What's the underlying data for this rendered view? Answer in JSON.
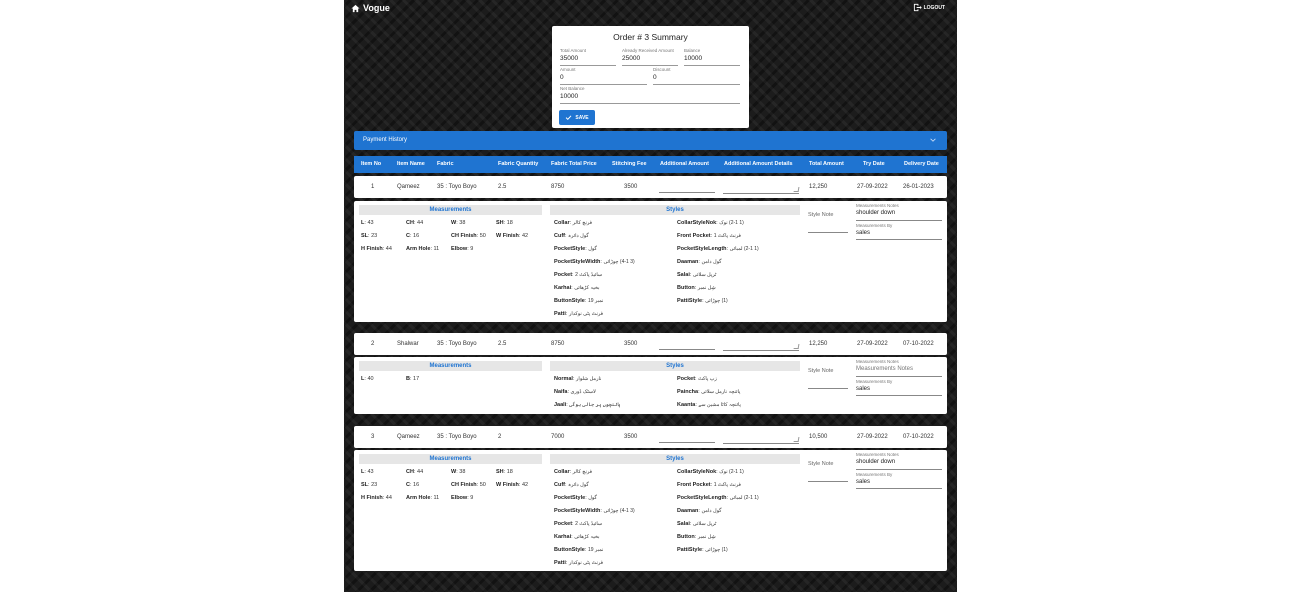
{
  "app": {
    "brand": "Vogue",
    "logout": "LOGOUT"
  },
  "summary": {
    "title": "Order # 3 Summary",
    "total_amount": {
      "label": "Total Amount",
      "value": "35000"
    },
    "already_received": {
      "label": "Already Received Amount",
      "value": "25000"
    },
    "balance": {
      "label": "Balance",
      "value": "10000"
    },
    "amount": {
      "label": "Amount",
      "value": "0"
    },
    "discount": {
      "label": "Discount",
      "value": "0"
    },
    "net_balance": {
      "label": "Net Balance",
      "value": "10000"
    },
    "save_label": "SAVE"
  },
  "payment_history": {
    "label": "Payment History"
  },
  "columns": [
    "Item No",
    "Item Name",
    "Fabric",
    "Fabric Quantity",
    "Fabric Total Price",
    "Stitching Fee",
    "Additional Amount",
    "Additional Amount Details",
    "Total Amount",
    "Try Date",
    "Delivery Date"
  ],
  "items": [
    {
      "no": "1",
      "name": "Qameez",
      "fabric": "35 : Toyo Boyo",
      "qty": "2.5",
      "fabric_price": "8750",
      "stitching_fee": "3500",
      "total": "12,250",
      "try_date": "27-09-2022",
      "delivery_date": "26-01-2023",
      "measurements_title": "Measurements",
      "styles_title": "Styles",
      "style_note": "Style Note",
      "notes_label": "Measurements Notes",
      "notes_value": "shoulder down",
      "by_label": "Measurements By",
      "by_value": "sales",
      "measurements": [
        {
          "k": "L",
          "v": "43"
        },
        {
          "k": "CH",
          "v": "44"
        },
        {
          "k": "W",
          "v": "38"
        },
        {
          "k": "SH",
          "v": "18"
        },
        {
          "k": "SL",
          "v": "23"
        },
        {
          "k": "C",
          "v": "16"
        },
        {
          "k": "CH Finish",
          "v": "50"
        },
        {
          "k": "W Finish",
          "v": "42"
        },
        {
          "k": "H Finish",
          "v": "44"
        },
        {
          "k": "Arm Hole",
          "v": "11"
        },
        {
          "k": "Elbow",
          "v": "9"
        }
      ],
      "styles_left": [
        {
          "k": "Collar",
          "v": "فرنچ کالر"
        },
        {
          "k": "Cuff",
          "v": "گول دائرہ"
        },
        {
          "k": "PocketStyle",
          "v": "گول"
        },
        {
          "k": "PocketStyleWidth",
          "v": "(3 4-1) چوڑائی"
        },
        {
          "k": "Pocket",
          "v": "سائیڈ پاکٹ 2"
        },
        {
          "k": "Karhai",
          "v": "بخیہ کڑھائی"
        },
        {
          "k": "ButtonStyle",
          "v": "نمبر 19"
        },
        {
          "k": "Patti",
          "v": "فرنٹ پٹی نوکدار"
        }
      ],
      "styles_right": [
        {
          "k": "CollarStyleNok",
          "v": "(1 2-1) نوک"
        },
        {
          "k": "Front Pocket",
          "v": "فرنٹ پاکٹ 1"
        },
        {
          "k": "PocketStyleLength",
          "v": "(1 2-1) لمبائی"
        },
        {
          "k": "Daaman",
          "v": "گول دامن"
        },
        {
          "k": "Salai",
          "v": "ٹرپل سلائی"
        },
        {
          "k": "Button",
          "v": "شِل نمبر"
        },
        {
          "k": "PattiStyle",
          "v": "(1) چوڑائی"
        }
      ]
    },
    {
      "no": "2",
      "name": "Shalwar",
      "fabric": "35 : Toyo Boyo",
      "qty": "2.5",
      "fabric_price": "8750",
      "stitching_fee": "3500",
      "total": "12,250",
      "try_date": "27-09-2022",
      "delivery_date": "07-10-2022",
      "measurements_title": "Measurements",
      "styles_title": "Styles",
      "style_note": "Style Note",
      "notes_label": "Measurements Notes",
      "notes_value": "",
      "by_label": "Measurements By",
      "by_value": "sales",
      "measurements": [
        {
          "k": "L",
          "v": "40"
        },
        {
          "k": "B",
          "v": "17"
        }
      ],
      "styles_left": [
        {
          "k": "Normal",
          "v": "نارمل شلوار"
        },
        {
          "k": "Naifa",
          "v": "لاسٹک ڈوری"
        },
        {
          "k": "Jaali",
          "v": "پائنچوں پر جالی ہوگی"
        }
      ],
      "styles_right": [
        {
          "k": "Pocket",
          "v": "زپ پاکٹ"
        },
        {
          "k": "Paincha",
          "v": "پائنچہ نارمل سلائی"
        },
        {
          "k": "Kaanta",
          "v": "پائنچہ کاٹا مشین سے"
        }
      ]
    },
    {
      "no": "3",
      "name": "Qameez",
      "fabric": "35 : Toyo Boyo",
      "qty": "2",
      "fabric_price": "7000",
      "stitching_fee": "3500",
      "total": "10,500",
      "try_date": "27-09-2022",
      "delivery_date": "07-10-2022",
      "measurements_title": "Measurements",
      "styles_title": "Styles",
      "style_note": "Style Note",
      "notes_label": "Measurements Notes",
      "notes_value": "shoulder down",
      "by_label": "Measurements By",
      "by_value": "sales",
      "measurements": [
        {
          "k": "L",
          "v": "43"
        },
        {
          "k": "CH",
          "v": "44"
        },
        {
          "k": "W",
          "v": "38"
        },
        {
          "k": "SH",
          "v": "18"
        },
        {
          "k": "SL",
          "v": "23"
        },
        {
          "k": "C",
          "v": "16"
        },
        {
          "k": "CH Finish",
          "v": "50"
        },
        {
          "k": "W Finish",
          "v": "42"
        },
        {
          "k": "H Finish",
          "v": "44"
        },
        {
          "k": "Arm Hole",
          "v": "11"
        },
        {
          "k": "Elbow",
          "v": "9"
        }
      ],
      "styles_left": [
        {
          "k": "Collar",
          "v": "فرنچ کالر"
        },
        {
          "k": "Cuff",
          "v": "گول دائرہ"
        },
        {
          "k": "PocketStyle",
          "v": "گول"
        },
        {
          "k": "PocketStyleWidth",
          "v": "(3 4-1) چوڑائی"
        },
        {
          "k": "Pocket",
          "v": "سائیڈ پاکٹ 2"
        },
        {
          "k": "Karhai",
          "v": "بخیہ کڑھائی"
        },
        {
          "k": "ButtonStyle",
          "v": "نمبر 19"
        },
        {
          "k": "Patti",
          "v": "فرنٹ پٹی نوکدار"
        }
      ],
      "styles_right": [
        {
          "k": "CollarStyleNok",
          "v": "(1 2-1) نوک"
        },
        {
          "k": "Front Pocket",
          "v": "فرنٹ پاکٹ 1"
        },
        {
          "k": "PocketStyleLength",
          "v": "(1 2-1) لمبائی"
        },
        {
          "k": "Daaman",
          "v": "گول دامن"
        },
        {
          "k": "Salai",
          "v": "ٹرپل سلائی"
        },
        {
          "k": "Button",
          "v": "شِل نمبر"
        },
        {
          "k": "PattiStyle",
          "v": "(1) چوڑائی"
        }
      ]
    }
  ]
}
